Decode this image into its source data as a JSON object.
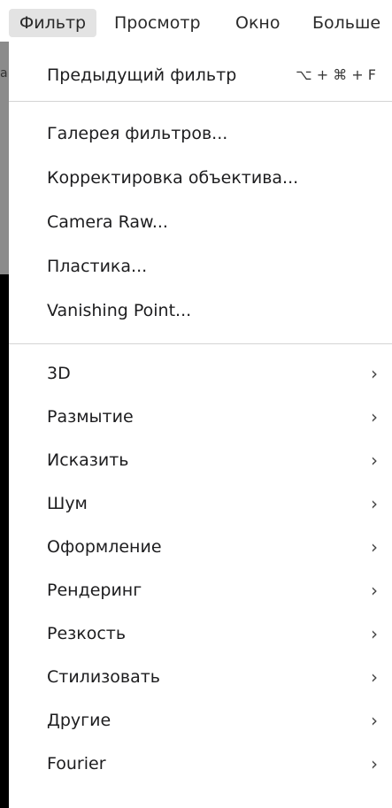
{
  "menubar": {
    "items": [
      {
        "label": "Фильтр",
        "active": true
      },
      {
        "label": "Просмотр",
        "active": false
      },
      {
        "label": "Окно",
        "active": false
      },
      {
        "label": "Больше",
        "active": false
      }
    ]
  },
  "background": {
    "partial_text": "a"
  },
  "menu": {
    "group1": [
      {
        "label": "Предыдущий фильтр",
        "shortcut": "⌥ + ⌘ + F"
      }
    ],
    "group2": [
      {
        "label": "Галерея фильтров..."
      },
      {
        "label": "Корректировка объектива..."
      },
      {
        "label": "Camera Raw..."
      },
      {
        "label": "Пластика..."
      },
      {
        "label": "Vanishing Point..."
      }
    ],
    "group3": [
      {
        "label": "3D",
        "submenu_icon": "chevron-right-icon"
      },
      {
        "label": "Размытие",
        "submenu_icon": "chevron-right-icon"
      },
      {
        "label": "Исказить",
        "submenu_icon": "chevron-right-icon"
      },
      {
        "label": "Шум",
        "submenu_icon": "chevron-right-icon"
      },
      {
        "label": "Оформление",
        "submenu_icon": "chevron-right-icon"
      },
      {
        "label": "Рендеринг",
        "submenu_icon": "chevron-right-icon"
      },
      {
        "label": "Резкость",
        "submenu_icon": "chevron-right-icon"
      },
      {
        "label": "Стилизовать",
        "submenu_icon": "chevron-right-icon"
      },
      {
        "label": "Другие",
        "submenu_icon": "chevron-right-icon"
      },
      {
        "label": "Fourier",
        "submenu_icon": "chevron-right-icon"
      }
    ],
    "chevron_glyph": "›"
  },
  "colors": {
    "menubar_active_bg": "#e3e3e3",
    "separator": "#d4d4d4",
    "text": "#1d1d1f"
  }
}
